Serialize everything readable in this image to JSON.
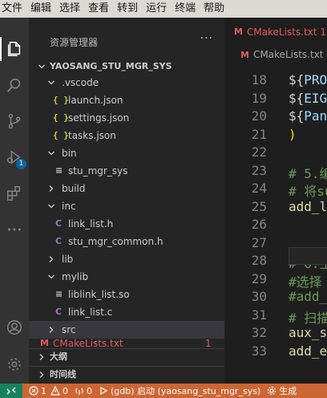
{
  "menubar": {
    "items": [
      "文件",
      "编辑",
      "选择",
      "查看",
      "转到",
      "运行",
      "终端",
      "帮助"
    ]
  },
  "activity_bar": {
    "items": [
      {
        "name": "explorer",
        "icon": "files-icon",
        "active": true
      },
      {
        "name": "search",
        "icon": "search-icon"
      },
      {
        "name": "source-control",
        "icon": "source-control-icon"
      },
      {
        "name": "run-debug",
        "icon": "debug-icon",
        "badge": "1"
      },
      {
        "name": "extensions",
        "icon": "extensions-icon"
      },
      {
        "name": "more",
        "icon": "ellipsis-icon"
      },
      {
        "name": "accounts",
        "icon": "account-icon"
      },
      {
        "name": "manage",
        "icon": "gear-icon"
      }
    ]
  },
  "sidebar": {
    "title": "资源管理器",
    "more": "···",
    "root": "YAOSANG_STU_MGR_SYS",
    "tree": [
      {
        "label": ".vscode",
        "type": "folder",
        "expanded": true
      },
      {
        "label": "launch.json",
        "type": "json",
        "icon": "{ }"
      },
      {
        "label": "settings.json",
        "type": "json",
        "icon": "{ }"
      },
      {
        "label": "tasks.json",
        "type": "json",
        "icon": "{ }"
      },
      {
        "label": "bin",
        "type": "folder",
        "expanded": true
      },
      {
        "label": "stu_mgr_sys",
        "type": "file",
        "icon": "≡"
      },
      {
        "label": "build",
        "type": "folder",
        "expanded": false
      },
      {
        "label": "inc",
        "type": "folder",
        "expanded": true
      },
      {
        "label": "link_list.h",
        "type": "c",
        "icon": "C"
      },
      {
        "label": "stu_mgr_common.h",
        "type": "c",
        "icon": "C"
      },
      {
        "label": "lib",
        "type": "folder",
        "expanded": false
      },
      {
        "label": "mylib",
        "type": "folder",
        "expanded": true
      },
      {
        "label": "liblink_list.so",
        "type": "file",
        "icon": "≡"
      },
      {
        "label": "link_list.c",
        "type": "c",
        "icon": "C"
      },
      {
        "label": "src",
        "type": "folder",
        "expanded": false
      }
    ],
    "open_editor": {
      "icon": "M",
      "label": "CMakeLists.txt",
      "count": "1"
    },
    "sections": [
      "大纲",
      "时间线"
    ]
  },
  "editor": {
    "tab": {
      "icon": "M",
      "label": "CMakeLists.txt 1"
    },
    "breadcrumb": {
      "icon": "M",
      "label": "CMakeLists.txt"
    },
    "lines": [
      {
        "num": "18",
        "text": "${PRO"
      },
      {
        "num": "19",
        "text": "${EIGE"
      },
      {
        "num": "20",
        "text": "${Pan"
      },
      {
        "num": "21",
        "text": ")"
      },
      {
        "num": "22",
        "text": ""
      },
      {
        "num": "23",
        "text": "# 5.编"
      },
      {
        "num": "24",
        "text": "# 将su"
      },
      {
        "num": "25",
        "text": "add_l"
      },
      {
        "num": "26",
        "text": ""
      },
      {
        "num": "27",
        "text": ""
      },
      {
        "num": "28",
        "text": "# 6.生"
      },
      {
        "num": "29",
        "text": "#选择"
      },
      {
        "num": "30",
        "text": "#add_"
      },
      {
        "num": "31",
        "text": "# 扫描"
      },
      {
        "num": "32",
        "text": "aux_s"
      },
      {
        "num": "33",
        "text": "add_e"
      }
    ]
  },
  "statusbar": {
    "remote_icon": "remote-icon",
    "errors": "1",
    "warnings": "0",
    "ports": "0",
    "debug": "(gdb) 启动 (yaosang_stu_mgr_sys)",
    "build": "生成",
    "colors": {
      "bg": "#cc6633",
      "remote": "#16825d"
    }
  }
}
